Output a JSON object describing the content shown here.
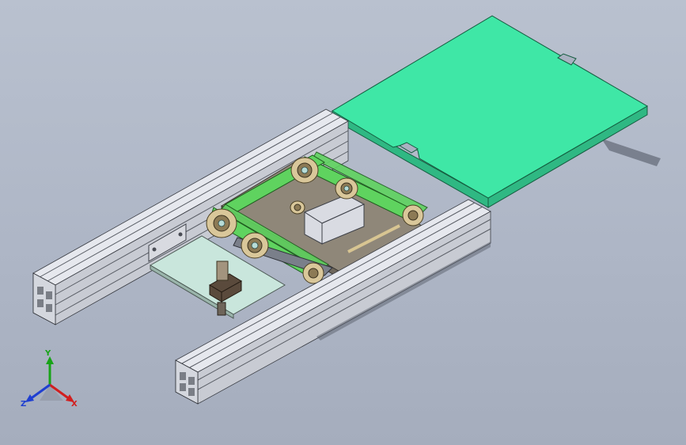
{
  "viewport": {
    "background_top": "#b9c1cf",
    "background_bottom": "#a5adbd"
  },
  "colors": {
    "rail": "#e6e8ee",
    "belt": "#5fd35f",
    "top_plate": "#3fe7a6",
    "pulley": "#d9c79a",
    "axis_x": "#d11f1f",
    "axis_y": "#18a318",
    "axis_z": "#1f3fd1"
  },
  "triad": {
    "x_label": "X",
    "y_label": "Y",
    "z_label": "Z",
    "icons": [
      "triad-axis-x-icon",
      "triad-axis-y-icon",
      "triad-axis-z-icon"
    ]
  }
}
